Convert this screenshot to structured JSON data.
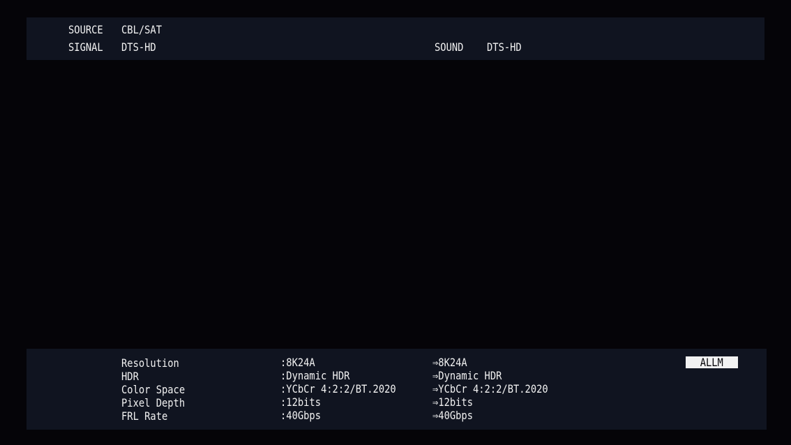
{
  "header": {
    "source_label": "SOURCE",
    "source_value": "CBL/SAT",
    "signal_label": "SIGNAL",
    "signal_value": "DTS-HD",
    "sound_label": "SOUND",
    "sound_value": "DTS-HD"
  },
  "info": {
    "rows": [
      {
        "label": "Resolution",
        "input": ":8K24A",
        "output": "⇒8K24A"
      },
      {
        "label": "HDR",
        "input": ":Dynamic HDR",
        "output": "⇒Dynamic HDR"
      },
      {
        "label": "Color Space",
        "input": ":YCbCr 4:2:2/BT.2020",
        "output": "⇒YCbCr 4:2:2/BT.2020"
      },
      {
        "label": "Pixel Depth",
        "input": ":12bits",
        "output": "⇒12bits"
      },
      {
        "label": "FRL Rate",
        "input": ":40Gbps",
        "output": "⇒40Gbps"
      }
    ],
    "badge": "ALLM"
  }
}
